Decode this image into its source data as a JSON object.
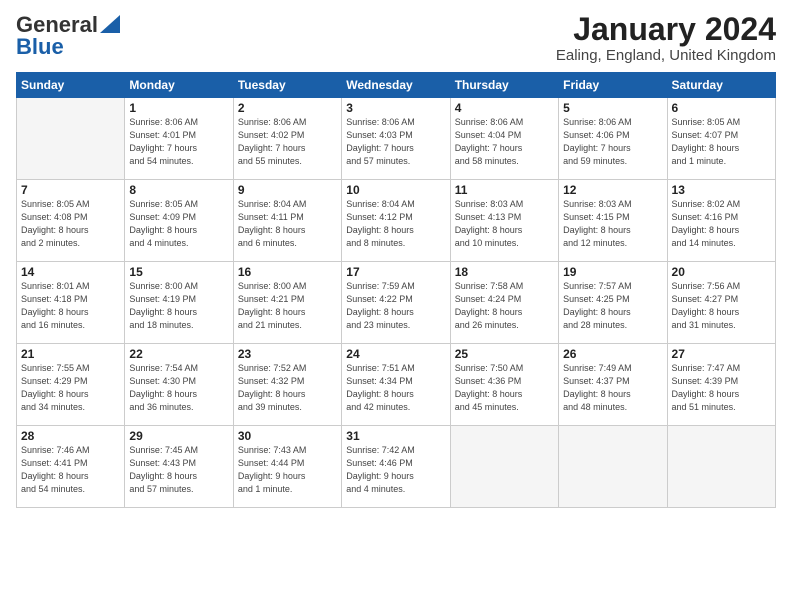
{
  "logo": {
    "general": "General",
    "blue": "Blue"
  },
  "header": {
    "month": "January 2024",
    "location": "Ealing, England, United Kingdom"
  },
  "weekdays": [
    "Sunday",
    "Monday",
    "Tuesday",
    "Wednesday",
    "Thursday",
    "Friday",
    "Saturday"
  ],
  "weeks": [
    [
      {
        "day": "",
        "sunrise": "",
        "sunset": "",
        "daylight": ""
      },
      {
        "day": "1",
        "sunrise": "Sunrise: 8:06 AM",
        "sunset": "Sunset: 4:01 PM",
        "daylight": "Daylight: 7 hours and 54 minutes."
      },
      {
        "day": "2",
        "sunrise": "Sunrise: 8:06 AM",
        "sunset": "Sunset: 4:02 PM",
        "daylight": "Daylight: 7 hours and 55 minutes."
      },
      {
        "day": "3",
        "sunrise": "Sunrise: 8:06 AM",
        "sunset": "Sunset: 4:03 PM",
        "daylight": "Daylight: 7 hours and 57 minutes."
      },
      {
        "day": "4",
        "sunrise": "Sunrise: 8:06 AM",
        "sunset": "Sunset: 4:04 PM",
        "daylight": "Daylight: 7 hours and 58 minutes."
      },
      {
        "day": "5",
        "sunrise": "Sunrise: 8:06 AM",
        "sunset": "Sunset: 4:06 PM",
        "daylight": "Daylight: 7 hours and 59 minutes."
      },
      {
        "day": "6",
        "sunrise": "Sunrise: 8:05 AM",
        "sunset": "Sunset: 4:07 PM",
        "daylight": "Daylight: 8 hours and 1 minute."
      }
    ],
    [
      {
        "day": "7",
        "sunrise": "Sunrise: 8:05 AM",
        "sunset": "Sunset: 4:08 PM",
        "daylight": "Daylight: 8 hours and 2 minutes."
      },
      {
        "day": "8",
        "sunrise": "Sunrise: 8:05 AM",
        "sunset": "Sunset: 4:09 PM",
        "daylight": "Daylight: 8 hours and 4 minutes."
      },
      {
        "day": "9",
        "sunrise": "Sunrise: 8:04 AM",
        "sunset": "Sunset: 4:11 PM",
        "daylight": "Daylight: 8 hours and 6 minutes."
      },
      {
        "day": "10",
        "sunrise": "Sunrise: 8:04 AM",
        "sunset": "Sunset: 4:12 PM",
        "daylight": "Daylight: 8 hours and 8 minutes."
      },
      {
        "day": "11",
        "sunrise": "Sunrise: 8:03 AM",
        "sunset": "Sunset: 4:13 PM",
        "daylight": "Daylight: 8 hours and 10 minutes."
      },
      {
        "day": "12",
        "sunrise": "Sunrise: 8:03 AM",
        "sunset": "Sunset: 4:15 PM",
        "daylight": "Daylight: 8 hours and 12 minutes."
      },
      {
        "day": "13",
        "sunrise": "Sunrise: 8:02 AM",
        "sunset": "Sunset: 4:16 PM",
        "daylight": "Daylight: 8 hours and 14 minutes."
      }
    ],
    [
      {
        "day": "14",
        "sunrise": "Sunrise: 8:01 AM",
        "sunset": "Sunset: 4:18 PM",
        "daylight": "Daylight: 8 hours and 16 minutes."
      },
      {
        "day": "15",
        "sunrise": "Sunrise: 8:00 AM",
        "sunset": "Sunset: 4:19 PM",
        "daylight": "Daylight: 8 hours and 18 minutes."
      },
      {
        "day": "16",
        "sunrise": "Sunrise: 8:00 AM",
        "sunset": "Sunset: 4:21 PM",
        "daylight": "Daylight: 8 hours and 21 minutes."
      },
      {
        "day": "17",
        "sunrise": "Sunrise: 7:59 AM",
        "sunset": "Sunset: 4:22 PM",
        "daylight": "Daylight: 8 hours and 23 minutes."
      },
      {
        "day": "18",
        "sunrise": "Sunrise: 7:58 AM",
        "sunset": "Sunset: 4:24 PM",
        "daylight": "Daylight: 8 hours and 26 minutes."
      },
      {
        "day": "19",
        "sunrise": "Sunrise: 7:57 AM",
        "sunset": "Sunset: 4:25 PM",
        "daylight": "Daylight: 8 hours and 28 minutes."
      },
      {
        "day": "20",
        "sunrise": "Sunrise: 7:56 AM",
        "sunset": "Sunset: 4:27 PM",
        "daylight": "Daylight: 8 hours and 31 minutes."
      }
    ],
    [
      {
        "day": "21",
        "sunrise": "Sunrise: 7:55 AM",
        "sunset": "Sunset: 4:29 PM",
        "daylight": "Daylight: 8 hours and 34 minutes."
      },
      {
        "day": "22",
        "sunrise": "Sunrise: 7:54 AM",
        "sunset": "Sunset: 4:30 PM",
        "daylight": "Daylight: 8 hours and 36 minutes."
      },
      {
        "day": "23",
        "sunrise": "Sunrise: 7:52 AM",
        "sunset": "Sunset: 4:32 PM",
        "daylight": "Daylight: 8 hours and 39 minutes."
      },
      {
        "day": "24",
        "sunrise": "Sunrise: 7:51 AM",
        "sunset": "Sunset: 4:34 PM",
        "daylight": "Daylight: 8 hours and 42 minutes."
      },
      {
        "day": "25",
        "sunrise": "Sunrise: 7:50 AM",
        "sunset": "Sunset: 4:36 PM",
        "daylight": "Daylight: 8 hours and 45 minutes."
      },
      {
        "day": "26",
        "sunrise": "Sunrise: 7:49 AM",
        "sunset": "Sunset: 4:37 PM",
        "daylight": "Daylight: 8 hours and 48 minutes."
      },
      {
        "day": "27",
        "sunrise": "Sunrise: 7:47 AM",
        "sunset": "Sunset: 4:39 PM",
        "daylight": "Daylight: 8 hours and 51 minutes."
      }
    ],
    [
      {
        "day": "28",
        "sunrise": "Sunrise: 7:46 AM",
        "sunset": "Sunset: 4:41 PM",
        "daylight": "Daylight: 8 hours and 54 minutes."
      },
      {
        "day": "29",
        "sunrise": "Sunrise: 7:45 AM",
        "sunset": "Sunset: 4:43 PM",
        "daylight": "Daylight: 8 hours and 57 minutes."
      },
      {
        "day": "30",
        "sunrise": "Sunrise: 7:43 AM",
        "sunset": "Sunset: 4:44 PM",
        "daylight": "Daylight: 9 hours and 1 minute."
      },
      {
        "day": "31",
        "sunrise": "Sunrise: 7:42 AM",
        "sunset": "Sunset: 4:46 PM",
        "daylight": "Daylight: 9 hours and 4 minutes."
      },
      {
        "day": "",
        "sunrise": "",
        "sunset": "",
        "daylight": ""
      },
      {
        "day": "",
        "sunrise": "",
        "sunset": "",
        "daylight": ""
      },
      {
        "day": "",
        "sunrise": "",
        "sunset": "",
        "daylight": ""
      }
    ]
  ]
}
